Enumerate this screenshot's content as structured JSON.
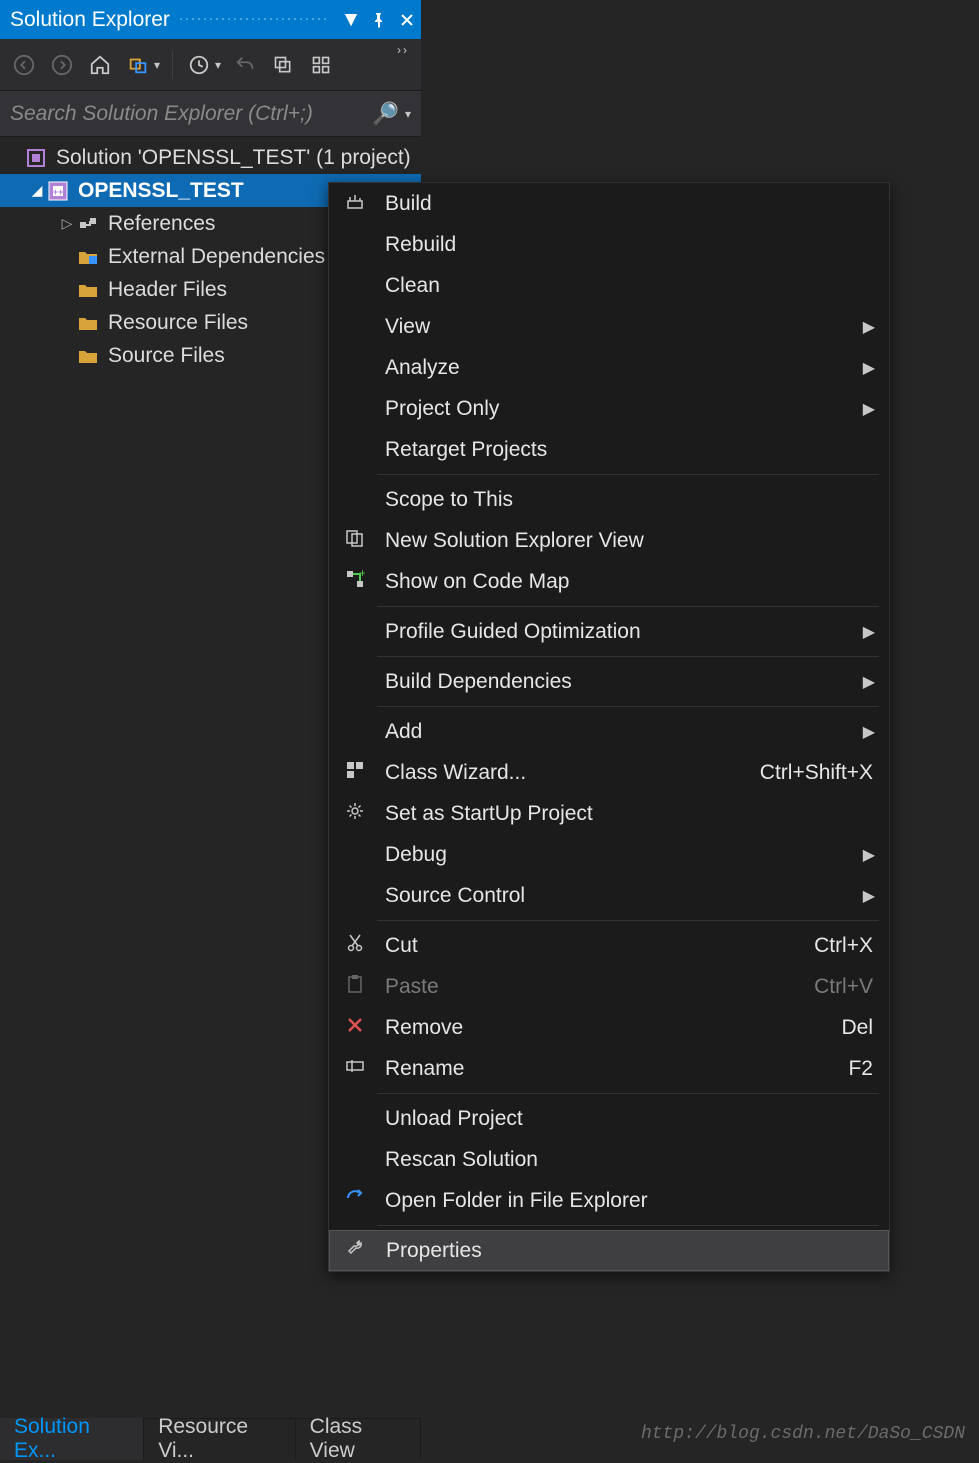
{
  "titleBar": {
    "title": "Solution Explorer"
  },
  "search": {
    "placeholder": "Search Solution Explorer (Ctrl+;)"
  },
  "tree": {
    "solution": "Solution 'OPENSSL_TEST' (1 project)",
    "project": "OPENSSL_TEST",
    "nodes": [
      "References",
      "External Dependencies",
      "Header Files",
      "Resource Files",
      "Source Files"
    ]
  },
  "contextMenu": {
    "groups": [
      [
        {
          "label": "Build",
          "icon": "build-icon"
        },
        {
          "label": "Rebuild"
        },
        {
          "label": "Clean"
        },
        {
          "label": "View",
          "submenu": true
        },
        {
          "label": "Analyze",
          "submenu": true
        },
        {
          "label": "Project Only",
          "submenu": true
        },
        {
          "label": "Retarget Projects"
        }
      ],
      [
        {
          "label": "Scope to This"
        },
        {
          "label": "New Solution Explorer View",
          "icon": "new-view-icon"
        },
        {
          "label": "Show on Code Map",
          "icon": "code-map-icon"
        }
      ],
      [
        {
          "label": "Profile Guided Optimization",
          "submenu": true
        }
      ],
      [
        {
          "label": "Build Dependencies",
          "submenu": true
        }
      ],
      [
        {
          "label": "Add",
          "submenu": true
        },
        {
          "label": "Class Wizard...",
          "icon": "class-wizard-icon",
          "shortcut": "Ctrl+Shift+X"
        },
        {
          "label": "Set as StartUp Project",
          "icon": "gear-icon"
        },
        {
          "label": "Debug",
          "submenu": true
        },
        {
          "label": "Source Control",
          "submenu": true
        }
      ],
      [
        {
          "label": "Cut",
          "icon": "cut-icon",
          "shortcut": "Ctrl+X"
        },
        {
          "label": "Paste",
          "icon": "paste-icon",
          "shortcut": "Ctrl+V",
          "disabled": true
        },
        {
          "label": "Remove",
          "icon": "remove-icon",
          "shortcut": "Del"
        },
        {
          "label": "Rename",
          "icon": "rename-icon",
          "shortcut": "F2"
        }
      ],
      [
        {
          "label": "Unload Project"
        },
        {
          "label": "Rescan Solution"
        },
        {
          "label": "Open Folder in File Explorer",
          "icon": "open-folder-icon"
        }
      ],
      [
        {
          "label": "Properties",
          "icon": "wrench-icon",
          "hover": true
        }
      ]
    ]
  },
  "tabs": {
    "items": [
      "Solution Ex...",
      "Resource Vi...",
      "Class View"
    ],
    "activeIndex": 0
  },
  "watermark": "http://blog.csdn.net/DaSo_CSDN"
}
